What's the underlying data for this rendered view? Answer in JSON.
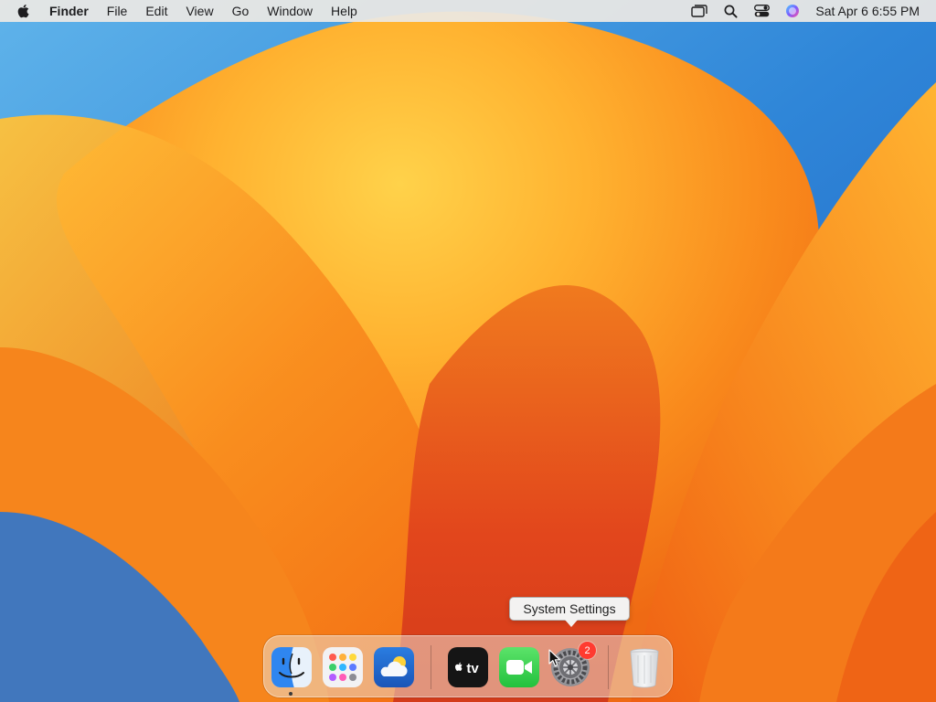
{
  "menubar": {
    "app_name": "Finder",
    "menus": [
      "File",
      "Edit",
      "View",
      "Go",
      "Window",
      "Help"
    ],
    "clock": "Sat Apr 6  6:55 PM",
    "status_icons": [
      "screen-mirroring-icon",
      "spotlight-search-icon",
      "control-center-icon",
      "siri-icon"
    ]
  },
  "tooltip": {
    "label": "System Settings"
  },
  "dock": {
    "apps": [
      "Finder",
      "Launchpad",
      "Weather",
      "TV",
      "FaceTime",
      "System Settings",
      "Trash"
    ],
    "settings_badge": "2",
    "tv_label": "tv"
  },
  "colors": {
    "menubar": "#ece8e4",
    "wallpaper_orange": "#f7931e",
    "wallpaper_blue": "#2f7fd6",
    "badge": "#ff3b30"
  }
}
